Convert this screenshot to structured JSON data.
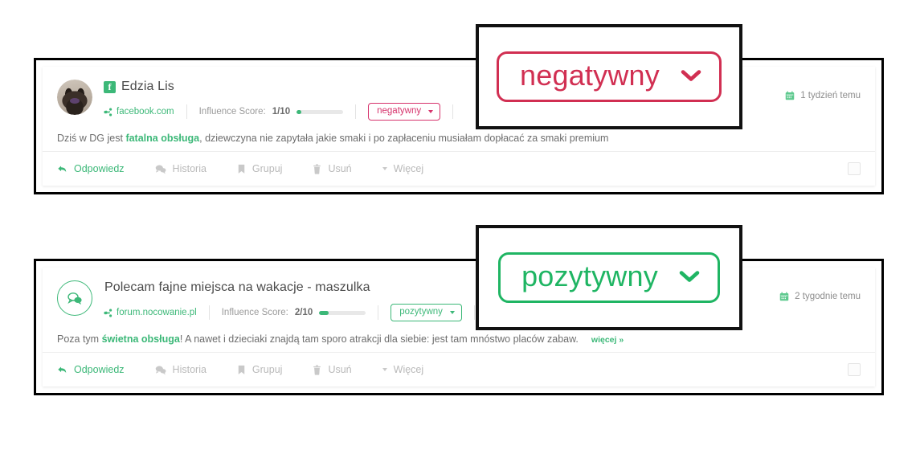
{
  "mentions": [
    {
      "avatar_type": "photo-cat",
      "source_badge_icon": "facebook-icon",
      "source_badge_letter": "f",
      "author": "Edzia Lis",
      "source_icon": "share-icon",
      "source": "facebook.com",
      "influence_label": "Influence Score:",
      "influence_value": "1/10",
      "influence_fill_pct": 10,
      "sentiment": "negatywny",
      "sentiment_tone": "negative",
      "date_icon": "calendar-icon",
      "date": "1 tydzień temu",
      "snippet_pre": "Dziś w DG jest ",
      "snippet_highlight": "fatalna obsługa",
      "snippet_post": ", dziewczyna nie zapytała jakie smaki i po zapłaceniu musiałam dopłacać za smaki premium",
      "more_link": "",
      "actions": [
        {
          "icon": "reply-icon",
          "label": "Odpowiedz",
          "primary": true
        },
        {
          "icon": "history-icon",
          "label": "Historia",
          "primary": false
        },
        {
          "icon": "bookmark-icon",
          "label": "Grupuj",
          "primary": false
        },
        {
          "icon": "trash-icon",
          "label": "Usuń",
          "primary": false
        },
        {
          "icon": "caret-down-icon",
          "label": "Więcej",
          "primary": false
        }
      ]
    },
    {
      "avatar_type": "ring-speech",
      "source_badge_icon": "",
      "source_badge_letter": "",
      "author": "Polecam fajne miejsca na wakacje - maszulka",
      "source_icon": "share-icon",
      "source": "forum.nocowanie.pl",
      "influence_label": "Influence Score:",
      "influence_value": "2/10",
      "influence_fill_pct": 20,
      "sentiment": "pozytywny",
      "sentiment_tone": "positive",
      "date_icon": "calendar-icon",
      "date": "2 tygodnie temu",
      "snippet_pre": "Poza tym ",
      "snippet_highlight": "świetna obsługa",
      "snippet_post": "! A nawet i dzieciaki znajdą tam sporo atrakcji dla siebie: jest tam mnóstwo placów zabaw.",
      "more_link": "więcej »",
      "actions": [
        {
          "icon": "reply-icon",
          "label": "Odpowiedz",
          "primary": true
        },
        {
          "icon": "history-icon",
          "label": "Historia",
          "primary": false
        },
        {
          "icon": "bookmark-icon",
          "label": "Grupuj",
          "primary": false
        },
        {
          "icon": "trash-icon",
          "label": "Usuń",
          "primary": false
        },
        {
          "icon": "caret-down-icon",
          "label": "Więcej",
          "primary": false
        }
      ]
    }
  ],
  "callouts": [
    {
      "label": "negatywny",
      "tone": "negative",
      "icon": "chevron-down-icon"
    },
    {
      "label": "pozytywny",
      "tone": "positive",
      "icon": "chevron-down-icon"
    }
  ],
  "colors": {
    "green": "#3cb878",
    "green_strong": "#1fb563",
    "red": "#d6336c",
    "red_strong": "#d12f52",
    "text": "#6d6d6d",
    "muted": "#b9b9b9",
    "frame": "#111111"
  }
}
